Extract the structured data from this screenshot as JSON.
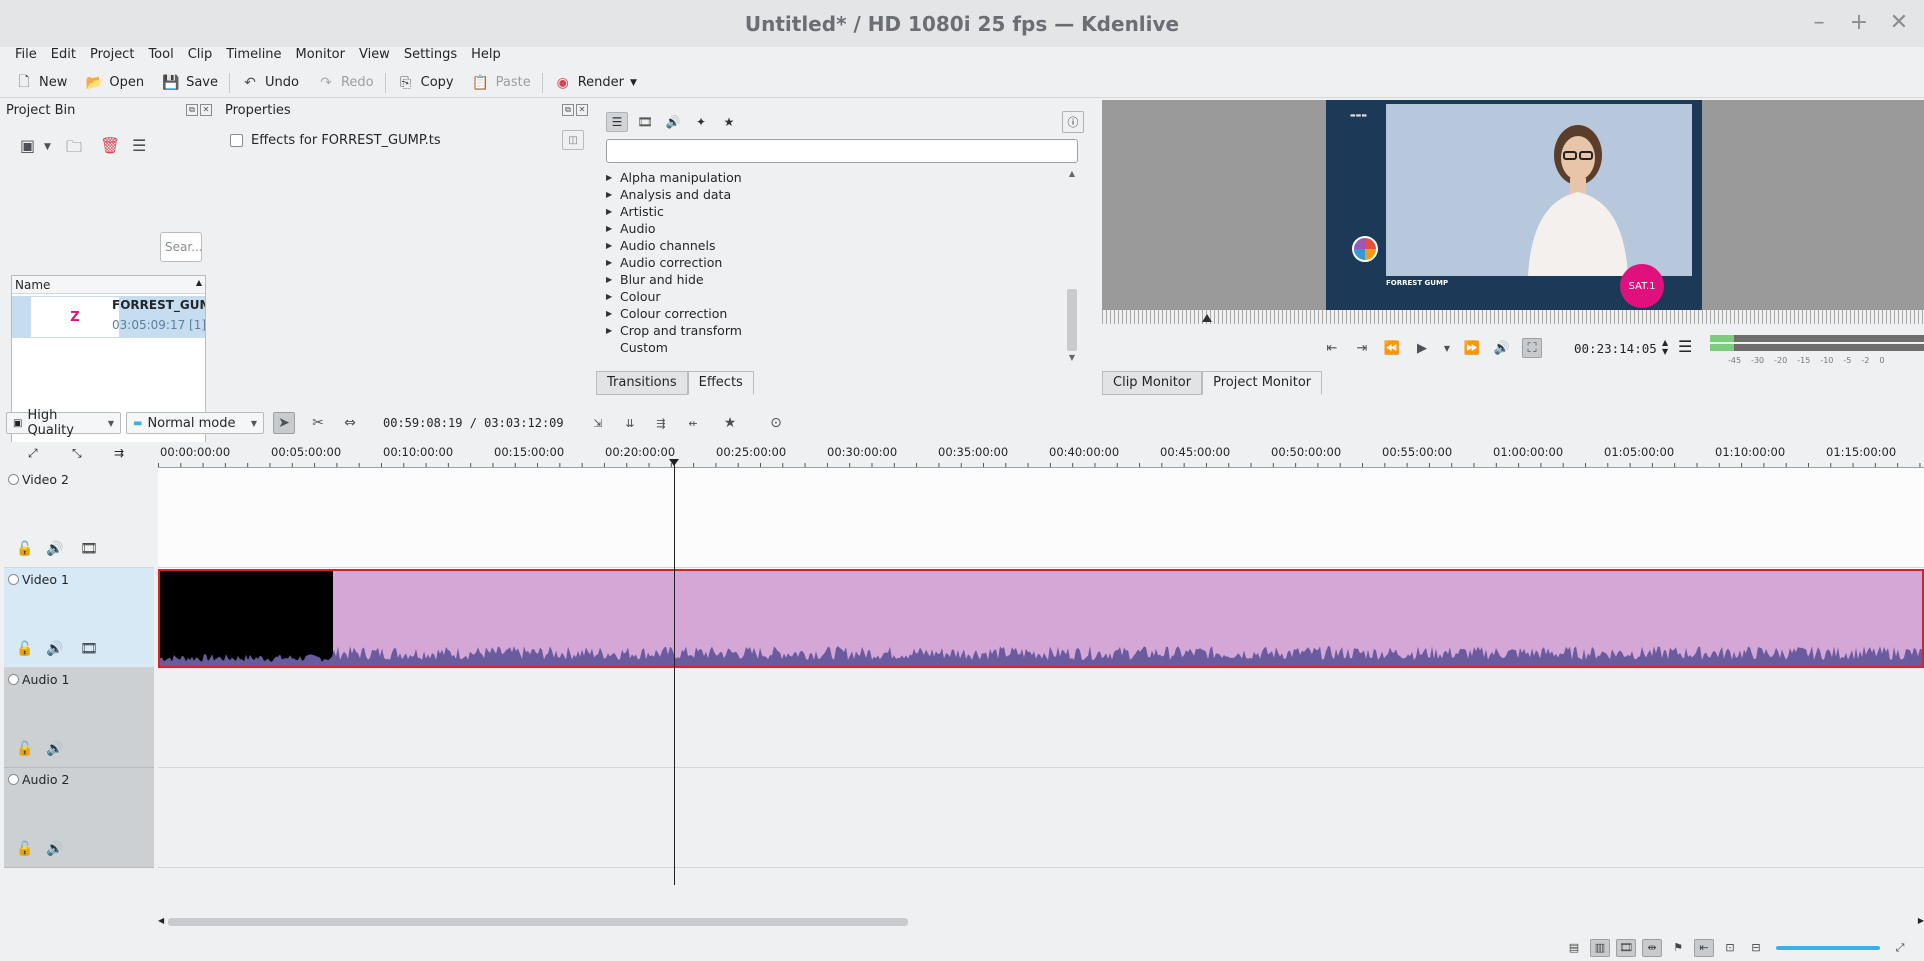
{
  "window": {
    "title": "Untitled* / HD 1080i 25 fps — Kdenlive",
    "controls": [
      "minimize-icon",
      "maximize-icon",
      "close-icon"
    ]
  },
  "menubar": {
    "items": [
      "File",
      "Edit",
      "Project",
      "Tool",
      "Clip",
      "Timeline",
      "Monitor",
      "View",
      "Settings",
      "Help"
    ]
  },
  "toolbar": {
    "new": "New",
    "open": "Open",
    "save": "Save",
    "undo": "Undo",
    "redo": "Redo",
    "copy": "Copy",
    "paste": "Paste",
    "render": "Render"
  },
  "project_bin": {
    "title": "Project Bin",
    "search_placeholder": "Sear...",
    "column_name": "Name",
    "items": [
      {
        "name": "FORREST_GUMP",
        "duration": "03:05:09:17",
        "usage": "[1]"
      }
    ]
  },
  "properties": {
    "title": "Properties",
    "checkbox_label": "Effects for FORREST_GUMP.ts"
  },
  "effects": {
    "categories": [
      "Alpha manipulation",
      "Analysis and data",
      "Artistic",
      "Audio",
      "Audio channels",
      "Audio correction",
      "Blur and hide",
      "Colour",
      "Colour correction",
      "Crop and transform",
      "Custom"
    ],
    "tabs": [
      "Transitions",
      "Effects"
    ],
    "active_tab": "Effects"
  },
  "monitor": {
    "timecode": "00:23:14:05",
    "tabs": [
      "Clip Monitor",
      "Project Monitor"
    ],
    "active_tab": "Project Monitor",
    "video_text": {
      "brand": "FORREST GUMP",
      "badge": "SAT.1"
    },
    "meter_labels": [
      "-45",
      "-30",
      "-20",
      "-15",
      "-10",
      "-5",
      "-2",
      "0"
    ],
    "meter_level": 0.11
  },
  "timeline_toolbar": {
    "quality": "High Quality",
    "mode": "Normal mode",
    "position": "00:59:08:19 / 03:03:12:09"
  },
  "timeline": {
    "ruler_ticks": [
      "00:00:00:00",
      "00:05:00:00",
      "00:10:00:00",
      "00:15:00:00",
      "00:20:00:00",
      "00:25:00:00",
      "00:30:00:00",
      "00:35:00:00",
      "00:40:00:00",
      "00:45:00:00",
      "00:50:00:00",
      "00:55:00:00",
      "01:00:00:00",
      "01:05:00:00",
      "01:10:00:00",
      "01:15:00:00"
    ],
    "tracks": [
      {
        "name": "Video 2",
        "type": "video"
      },
      {
        "name": "Video 1",
        "type": "video"
      },
      {
        "name": "Audio 1",
        "type": "audio"
      },
      {
        "name": "Audio 2",
        "type": "audio"
      }
    ]
  },
  "colors": {
    "clip_fill": "#d4a7d7",
    "clip_border": "#e0201e",
    "selection": "#c6dcef",
    "accent": "#3daee9"
  }
}
